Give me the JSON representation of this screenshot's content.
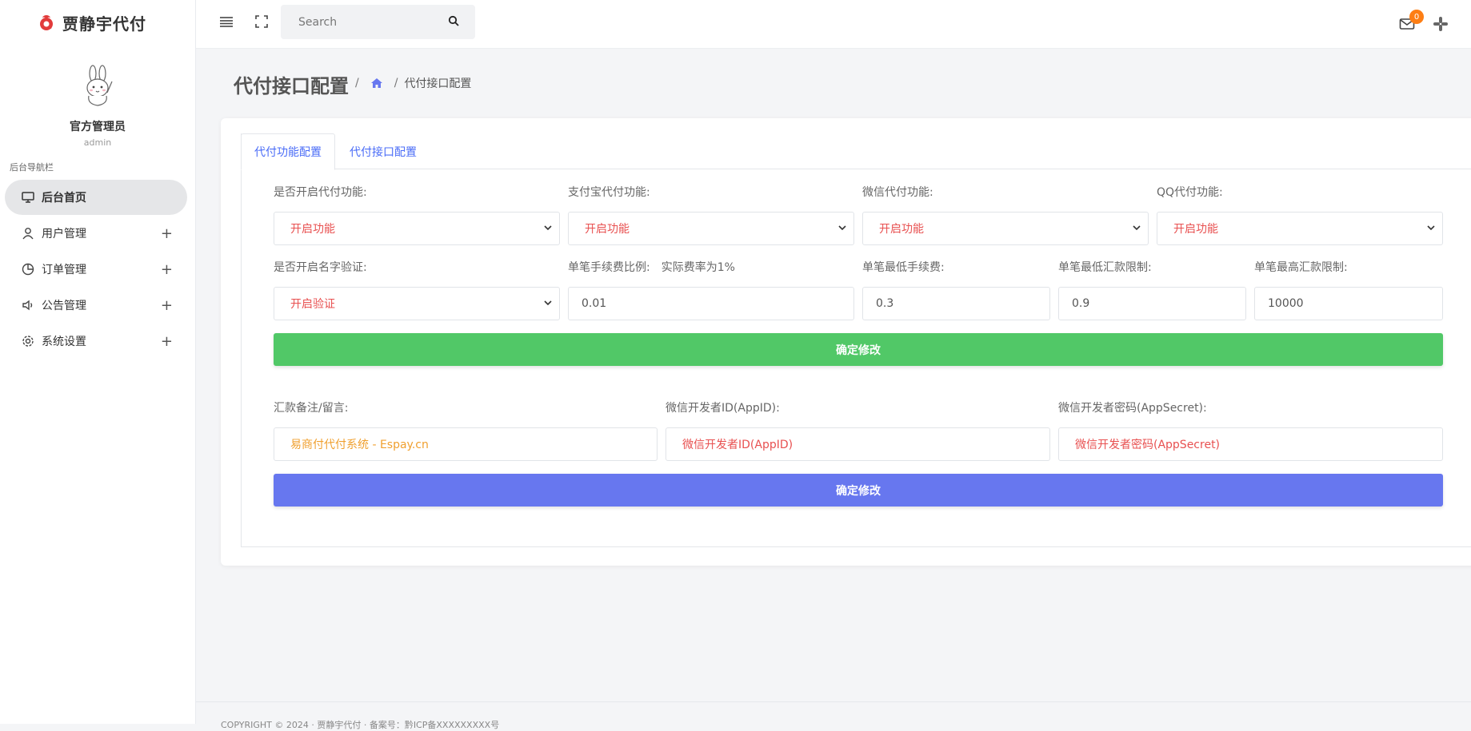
{
  "brand": {
    "name": "贾静宇代付"
  },
  "profile": {
    "name": "官方管理员",
    "role": "admin"
  },
  "sidebar": {
    "caption": "后台导航栏",
    "items": [
      {
        "label": "后台首页",
        "icon": "monitor-icon",
        "active": true
      },
      {
        "label": "用户管理",
        "icon": "user-icon",
        "expand": "+"
      },
      {
        "label": "订单管理",
        "icon": "pie-chart-icon",
        "expand": "+"
      },
      {
        "label": "公告管理",
        "icon": "speaker-icon",
        "expand": "+"
      },
      {
        "label": "系统设置",
        "icon": "gear-icon",
        "expand": "+"
      }
    ]
  },
  "topbar": {
    "search_placeholder": "Search",
    "mail_badge": "0"
  },
  "page": {
    "title": "代付接口配置",
    "breadcrumb_sep": "/",
    "breadcrumb_current": "代付接口配置"
  },
  "tabs": [
    {
      "label": "代付功能配置",
      "active": true
    },
    {
      "label": "代付接口配置",
      "active": false
    }
  ],
  "form1": {
    "row1": [
      {
        "label": "是否开启代付功能:",
        "value": "开启功能"
      },
      {
        "label": "支付宝代付功能:",
        "value": "开启功能"
      },
      {
        "label": "微信代付功能:",
        "value": "开启功能"
      },
      {
        "label": "QQ代付功能:",
        "value": "开启功能"
      }
    ],
    "row2": {
      "verify_label": "是否开启名字验证:",
      "verify_value": "开启验证",
      "fee_ratio_label": "单笔手续费比例:",
      "fee_ratio_note": "实际费率为1%",
      "fee_ratio_value": "0.01",
      "min_fee_label": "单笔最低手续费:",
      "min_fee_value": "0.3",
      "min_limit_label": "单笔最低汇款限制:",
      "min_limit_value": "0.9",
      "max_limit_label": "单笔最高汇款限制:",
      "max_limit_value": "10000"
    },
    "submit_label": "确定修改"
  },
  "form2": {
    "remark_label": "汇款备注/留言:",
    "remark_value": "易商付代付系统 - Espay.cn",
    "appid_label": "微信开发者ID(AppID):",
    "appid_value": "微信开发者ID(AppID)",
    "secret_label": "微信开发者密码(AppSecret):",
    "secret_value": "微信开发者密码(AppSecret)",
    "submit_label": "确定修改"
  },
  "footer": {
    "text": "COPYRIGHT © 2024 · 贾静宇代付 · 备案号：黔ICP备XXXXXXXXX号"
  },
  "colors": {
    "accent": "#6777ef",
    "success": "#51c867",
    "danger": "#e85050",
    "warning": "#f0a02f",
    "badge": "#fd7e14"
  }
}
